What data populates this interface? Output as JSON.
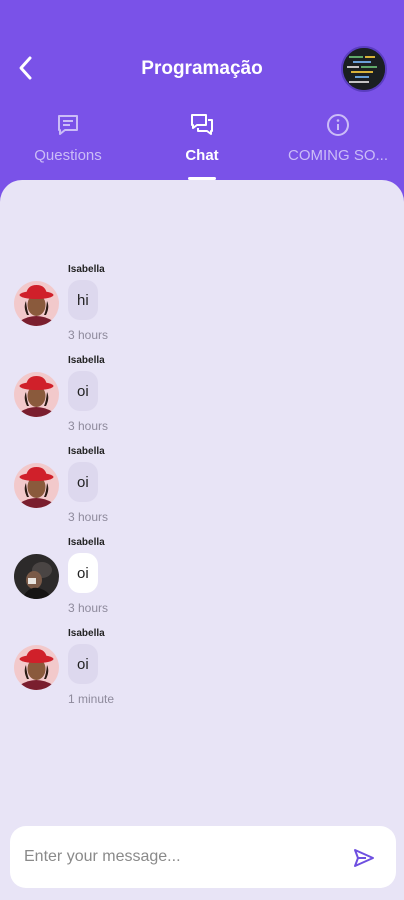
{
  "header": {
    "title": "Programação",
    "colors": {
      "primary": "#7a52e8",
      "background": "#e8e4f6",
      "inactive_tab": "#cbbcf7"
    }
  },
  "tabs": [
    {
      "label": "Questions",
      "icon": "message-square-icon",
      "active": false
    },
    {
      "label": "Chat",
      "icon": "chat-bubbles-icon",
      "active": true
    },
    {
      "label": "COMING SO...",
      "icon": "info-icon",
      "active": false
    }
  ],
  "messages": [
    {
      "author": "Isabella",
      "text": "hi",
      "time": "3 hours",
      "avatar": "red-hat-avatar"
    },
    {
      "author": "Isabella",
      "text": "oi",
      "time": "3 hours",
      "avatar": "red-hat-avatar"
    },
    {
      "author": "Isabella",
      "text": "oi",
      "time": "3 hours",
      "avatar": "red-hat-avatar"
    },
    {
      "author": "Isabella",
      "text": "oi",
      "time": "3 hours",
      "avatar": "dark-photo-avatar"
    },
    {
      "author": "Isabella",
      "text": "oi",
      "time": "1 minute",
      "avatar": "red-hat-avatar"
    }
  ],
  "composer": {
    "placeholder": "Enter your message...",
    "value": ""
  }
}
